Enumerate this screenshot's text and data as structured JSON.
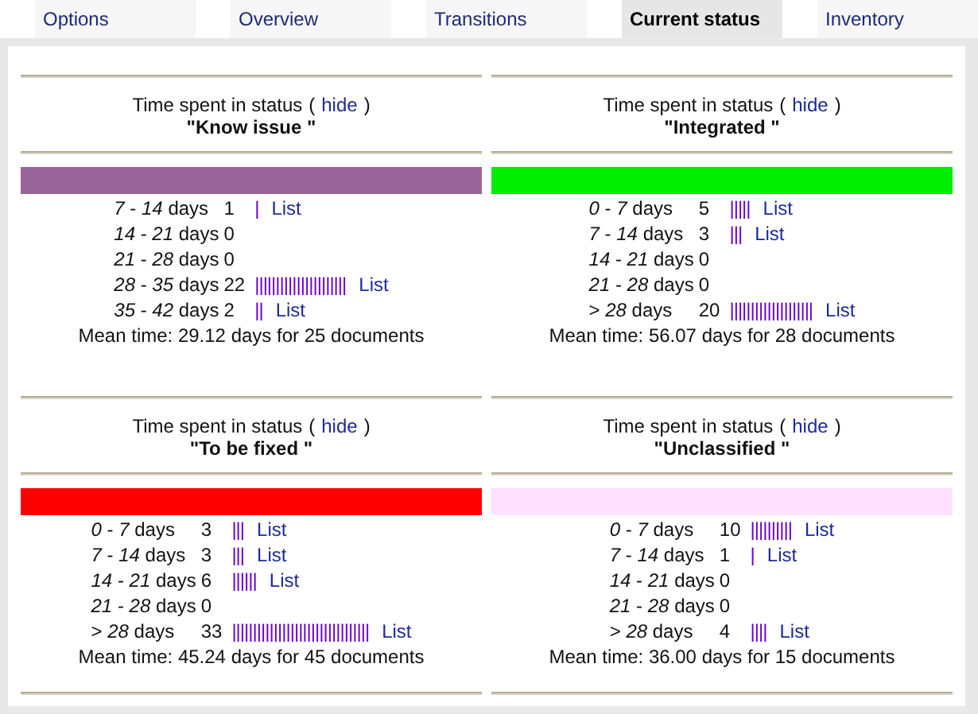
{
  "tabs": [
    {
      "label": "Options",
      "selected": false
    },
    {
      "label": "Overview",
      "selected": false
    },
    {
      "label": "Transitions",
      "selected": false
    },
    {
      "label": "Current status",
      "selected": true
    },
    {
      "label": "Inventory",
      "selected": false
    }
  ],
  "cards": [
    {
      "heading": "Time spent in status",
      "open_paren": "(",
      "hide_link": "hide",
      "close_paren": ")",
      "status": "\"Know issue \"",
      "color": "#996699",
      "rows": [
        {
          "range": "*7* - *14* days",
          "count": "1",
          "bars": "|",
          "link": "List"
        },
        {
          "range": "*14* - *21* days",
          "count": "0"
        },
        {
          "range": "*21* - *28* days",
          "count": "0"
        },
        {
          "range": "*28* - *35* days",
          "count": "22",
          "bars": "||||||||||||||||||||||",
          "link": "List"
        },
        {
          "range": "*35* - *42* days",
          "count": "2",
          "bars": "||",
          "link": "List"
        }
      ],
      "mean": "Mean time: 29.12 days for 25 documents"
    },
    {
      "heading": "Time spent in status",
      "open_paren": "(",
      "hide_link": "hide",
      "close_paren": ")",
      "status": "\"Integrated \"",
      "color": "#00ee00",
      "rows": [
        {
          "range": "*0* - *7* days",
          "count": "5",
          "bars": "|||||",
          "link": "List"
        },
        {
          "range": "*7* - *14* days",
          "count": "3",
          "bars": "|||",
          "link": "List"
        },
        {
          "range": "*14* - *21* days",
          "count": "0"
        },
        {
          "range": "*21* - *28* days",
          "count": "0"
        },
        {
          "range": "> *28* days",
          "count": "20",
          "bars": "||||||||||||||||||||",
          "link": "List"
        }
      ],
      "mean": "Mean time: 56.07 days for 28 documents"
    },
    {
      "heading": "Time spent in status",
      "open_paren": "(",
      "hide_link": "hide",
      "close_paren": ")",
      "status": "\"To be fixed \"",
      "color": "#ff0000",
      "rows": [
        {
          "range": "*0* - *7* days",
          "count": "3",
          "bars": "|||",
          "link": "List"
        },
        {
          "range": "*7* - *14* days",
          "count": "3",
          "bars": "|||",
          "link": "List"
        },
        {
          "range": "*14* - *21* days",
          "count": "6",
          "bars": "||||||",
          "link": "List"
        },
        {
          "range": "*21* - *28* days",
          "count": "0"
        },
        {
          "range": "> *28* days",
          "count": "33",
          "bars": "|||||||||||||||||||||||||||||||||",
          "link": "List"
        }
      ],
      "mean": "Mean time: 45.24 days for 45 documents"
    },
    {
      "heading": "Time spent in status",
      "open_paren": "(",
      "hide_link": "hide",
      "close_paren": ")",
      "status": "\"Unclassified \"",
      "color": "#ffe0ff",
      "rows": [
        {
          "range": "*0* - *7* days",
          "count": "10",
          "bars": "||||||||||",
          "link": "List"
        },
        {
          "range": "*7* - *14* days",
          "count": "1",
          "bars": "|",
          "link": "List"
        },
        {
          "range": "*14* - *21* days",
          "count": "0"
        },
        {
          "range": "*21* - *28* days",
          "count": "0"
        },
        {
          "range": "> *28* days",
          "count": "4",
          "bars": "||||",
          "link": "List"
        }
      ],
      "mean": "Mean time: 36.00 days for 15 documents"
    }
  ]
}
